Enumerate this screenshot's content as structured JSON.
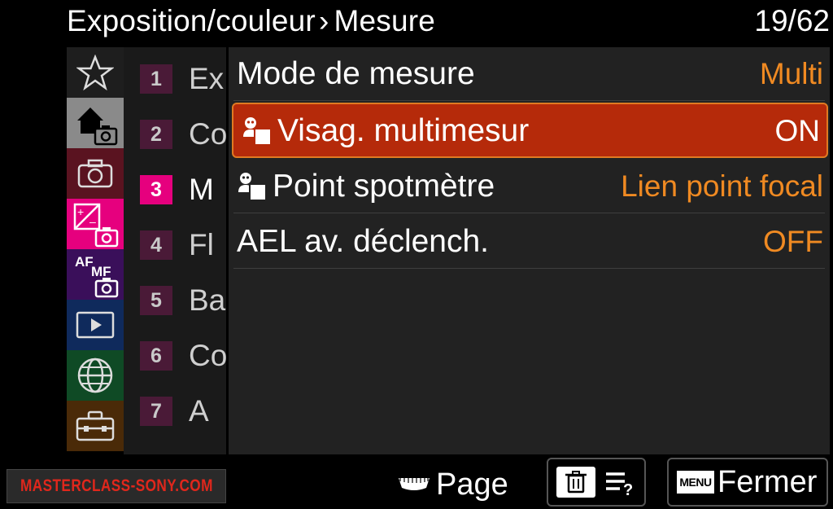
{
  "header": {
    "breadcrumb": "Exposition/couleur",
    "separator": "›",
    "title": "Mesure",
    "page_counter": "19/62"
  },
  "categories": [
    {
      "icon": "star-icon",
      "color": "#1e1e1e"
    },
    {
      "icon": "home-camera-icon",
      "color": "#8a8a8a"
    },
    {
      "icon": "camera-icon",
      "color": "#5a1320"
    },
    {
      "icon": "exposure-camera-icon",
      "color": "#e6007e"
    },
    {
      "icon": "af-mf-camera-icon",
      "color": "#3a0f5a",
      "text_af": "AF",
      "text_mf": "MF"
    },
    {
      "icon": "playback-icon",
      "color": "#0f2a5c"
    },
    {
      "icon": "globe-icon",
      "color": "#0f4a25"
    },
    {
      "icon": "toolbox-icon",
      "color": "#4a2a08"
    }
  ],
  "subtabs": [
    {
      "num": "1",
      "label": "Ex"
    },
    {
      "num": "2",
      "label": "Co"
    },
    {
      "num": "3",
      "label": "M"
    },
    {
      "num": "4",
      "label": "Fl"
    },
    {
      "num": "5",
      "label": "Ba"
    },
    {
      "num": "6",
      "label": "Co"
    },
    {
      "num": "7",
      "label": "A"
    }
  ],
  "items": [
    {
      "label": "Mode de mesure",
      "value": "Multi",
      "icon": ""
    },
    {
      "label": "Visag. multimesur",
      "value": "ON",
      "icon": "face-priority-icon"
    },
    {
      "label": "Point spotmètre",
      "value": "Lien point focal",
      "icon": "face-priority-icon"
    },
    {
      "label": "AEL av. déclench.",
      "value": "OFF",
      "icon": ""
    }
  ],
  "footer": {
    "brand": "MASTERCLASS-SONY.COM",
    "page_label": "Page",
    "menu_badge": "MENU",
    "close_label": "Fermer",
    "help_glyph": "?"
  },
  "colors": {
    "value": "#f08a22",
    "selection": "#b52a0a",
    "active_tab": "#e6007e",
    "brand": "#e0271c"
  }
}
